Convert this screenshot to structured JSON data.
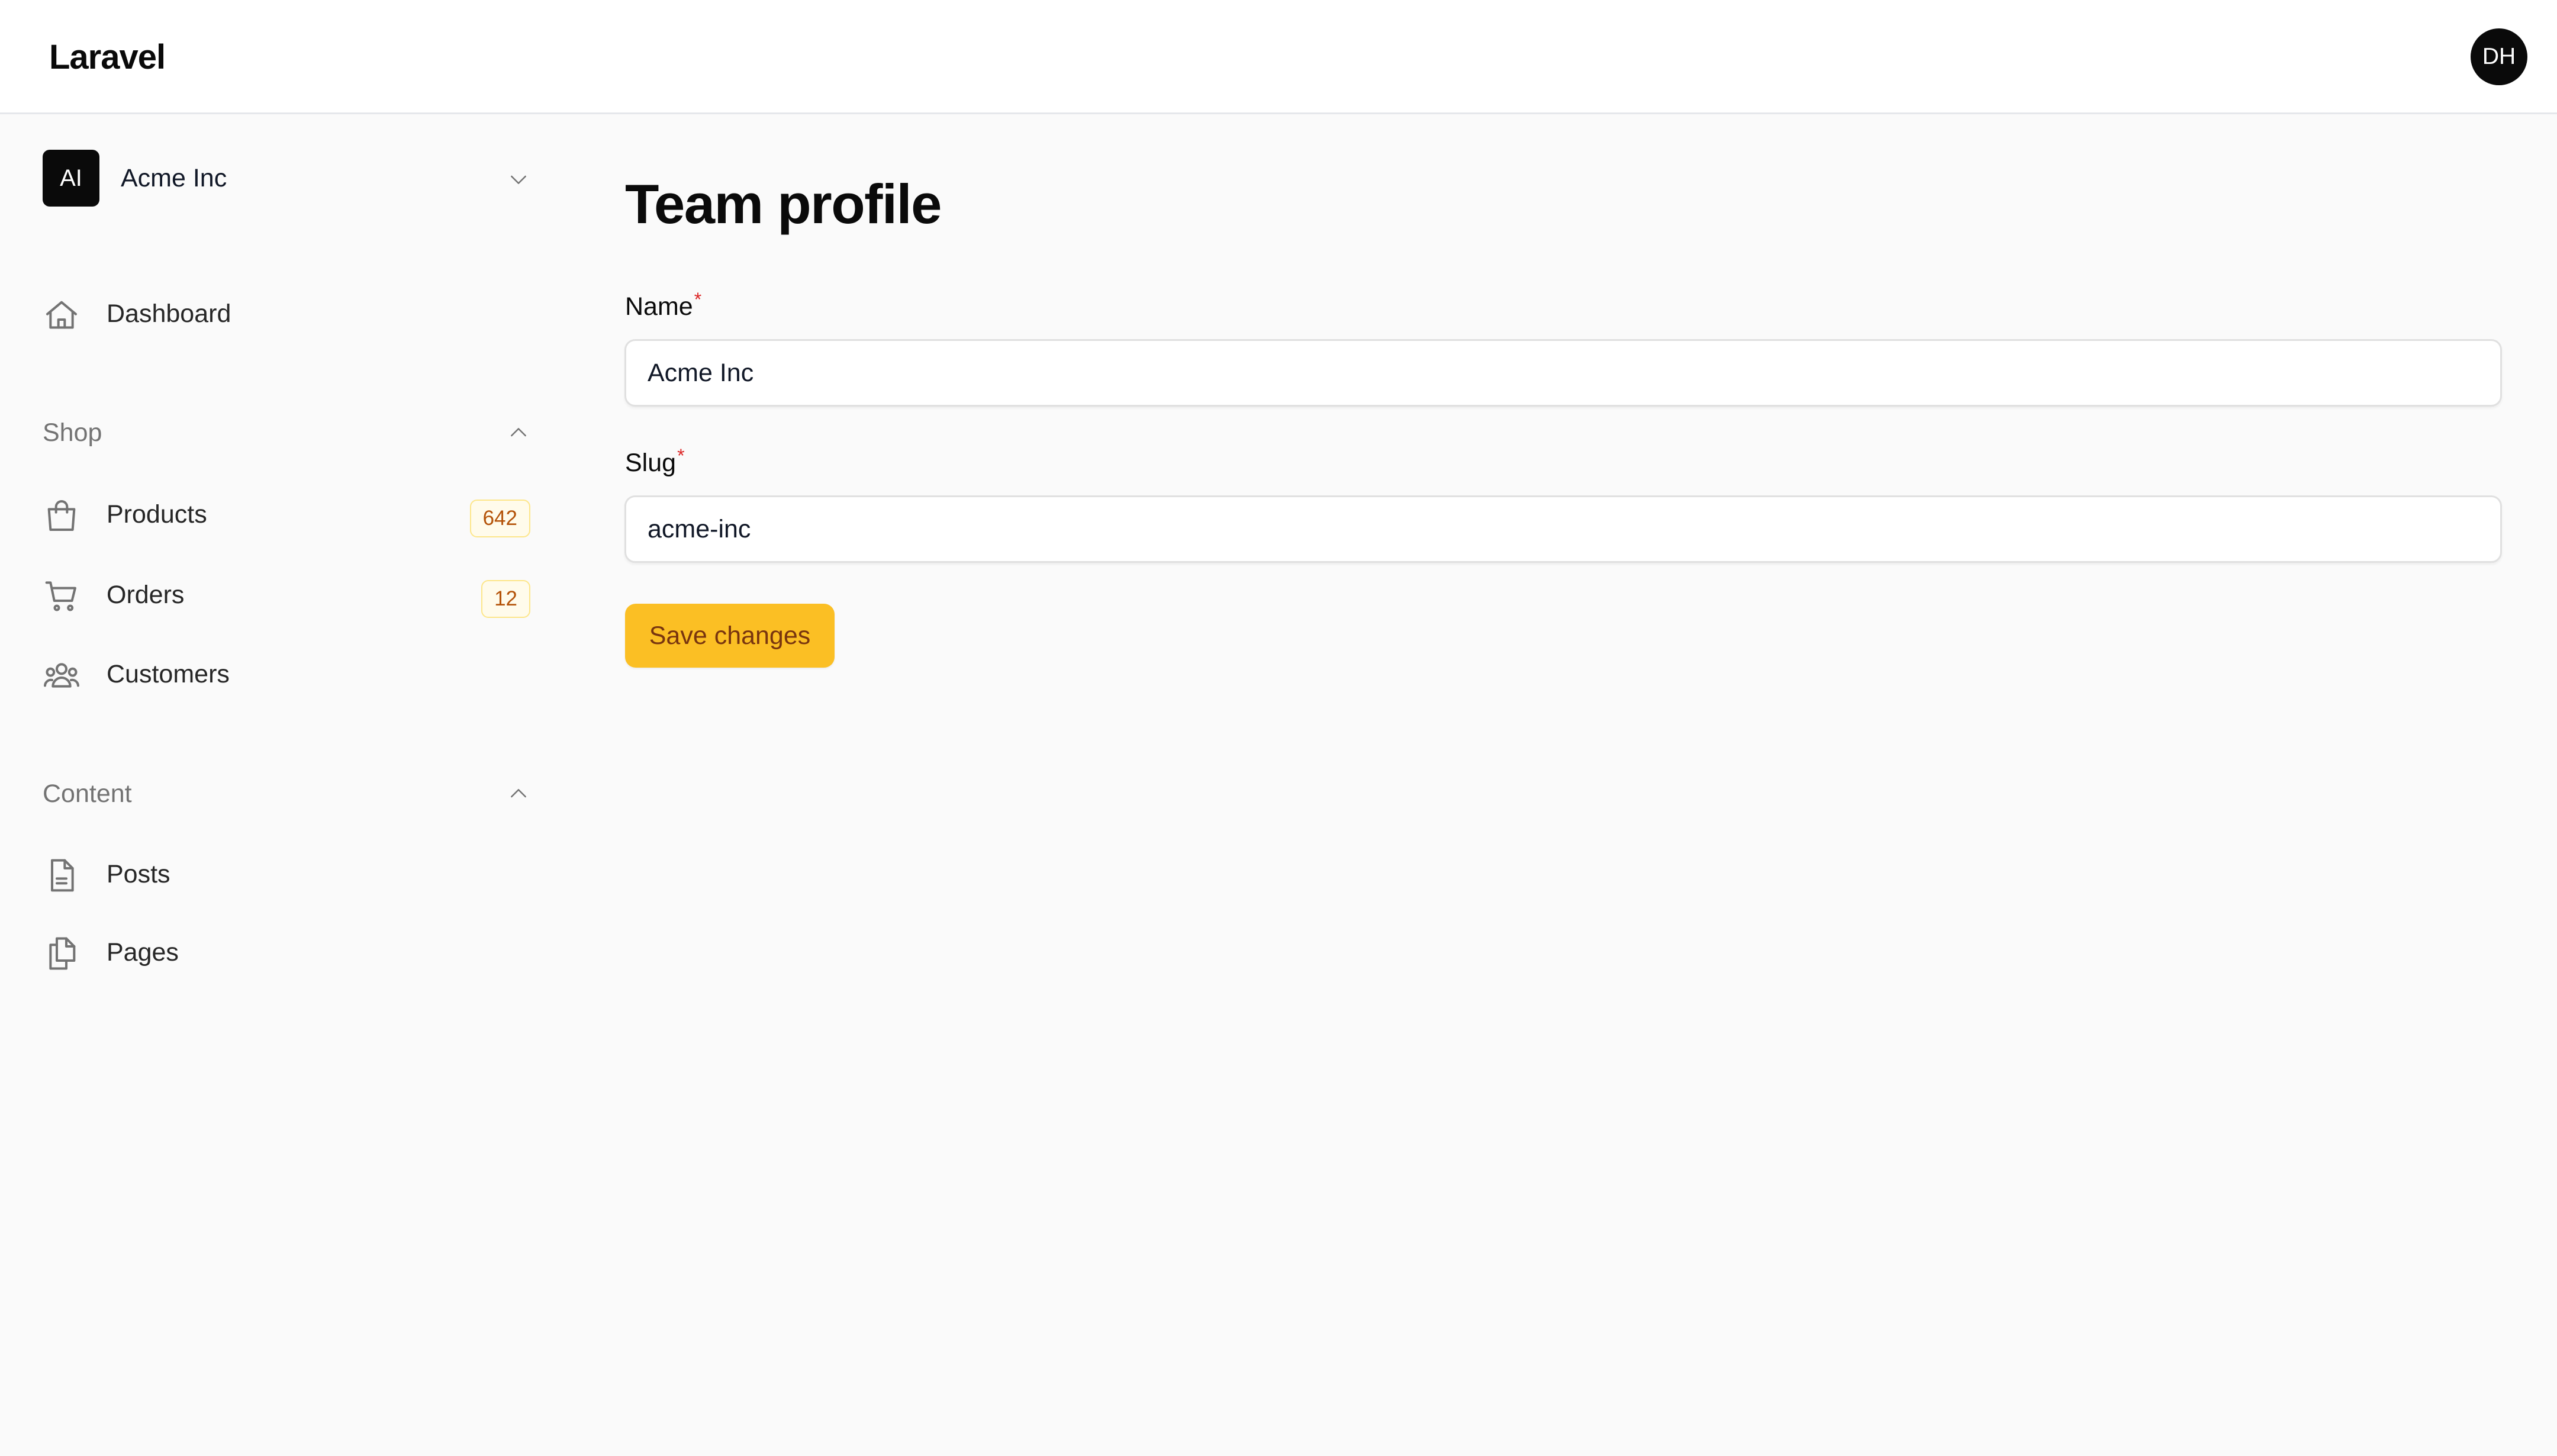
{
  "header": {
    "brand": "Laravel",
    "user_initials": "DH"
  },
  "sidebar": {
    "team": {
      "initials": "AI",
      "name": "Acme Inc",
      "chevron_icon": "chevron-down-icon"
    },
    "dashboard": {
      "label": "Dashboard",
      "icon": "home-icon"
    },
    "groups": [
      {
        "label": "Shop",
        "expanded": true,
        "items": [
          {
            "label": "Products",
            "badge": "642",
            "icon": "shopping-bag-icon"
          },
          {
            "label": "Orders",
            "badge": "12",
            "icon": "shopping-cart-icon"
          },
          {
            "label": "Customers",
            "icon": "users-icon"
          }
        ]
      },
      {
        "label": "Content",
        "expanded": true,
        "items": [
          {
            "label": "Posts",
            "icon": "document-icon"
          },
          {
            "label": "Pages",
            "icon": "pages-icon"
          }
        ]
      }
    ]
  },
  "main": {
    "title": "Team profile",
    "fields": [
      {
        "label": "Name",
        "required_mark": "*",
        "value": "Acme Inc"
      },
      {
        "label": "Slug",
        "required_mark": "*",
        "value": "acme-inc"
      }
    ],
    "save_label": "Save changes"
  },
  "colors": {
    "accent": "#fbbf24",
    "accent_text": "#78350f",
    "badge_text": "#b45309",
    "badge_bg": "#fffbeb",
    "required": "#dc2626"
  }
}
